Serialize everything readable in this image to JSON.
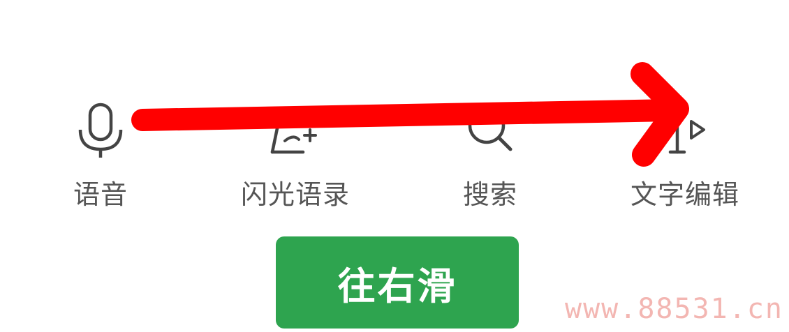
{
  "toolbar": {
    "items": [
      {
        "label": "语音",
        "icon": "microphone-icon"
      },
      {
        "label": "闪光语录",
        "icon": "flash-quote-icon"
      },
      {
        "label": "搜索",
        "icon": "search-icon"
      },
      {
        "label": "文字编辑",
        "icon": "text-edit-icon"
      }
    ]
  },
  "action_button": {
    "label": "往右滑"
  },
  "overlay": {
    "arrow_color": "#ff0000",
    "direction": "right"
  },
  "watermark": {
    "text": "www.88531.cn"
  },
  "colors": {
    "button_bg": "#2ea44f",
    "label_text": "#555555",
    "icon_stroke": "#444444"
  }
}
